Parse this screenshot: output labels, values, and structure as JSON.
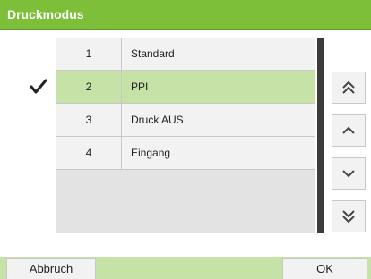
{
  "title": "Druckmodus",
  "items": [
    {
      "num": "1",
      "label": "Standard"
    },
    {
      "num": "2",
      "label": "PPI"
    },
    {
      "num": "3",
      "label": "Druck AUS"
    },
    {
      "num": "4",
      "label": "Eingang"
    }
  ],
  "selected_index": 1,
  "nav_icons": [
    "double-chevron-up-icon",
    "chevron-up-icon",
    "chevron-down-icon",
    "double-chevron-down-icon"
  ],
  "buttons": {
    "cancel": "Abbruch",
    "ok": "OK"
  },
  "colors": {
    "accent": "#7ebf3a",
    "selected": "#c6e2a6",
    "scrollbar": "#3c3c3c"
  }
}
